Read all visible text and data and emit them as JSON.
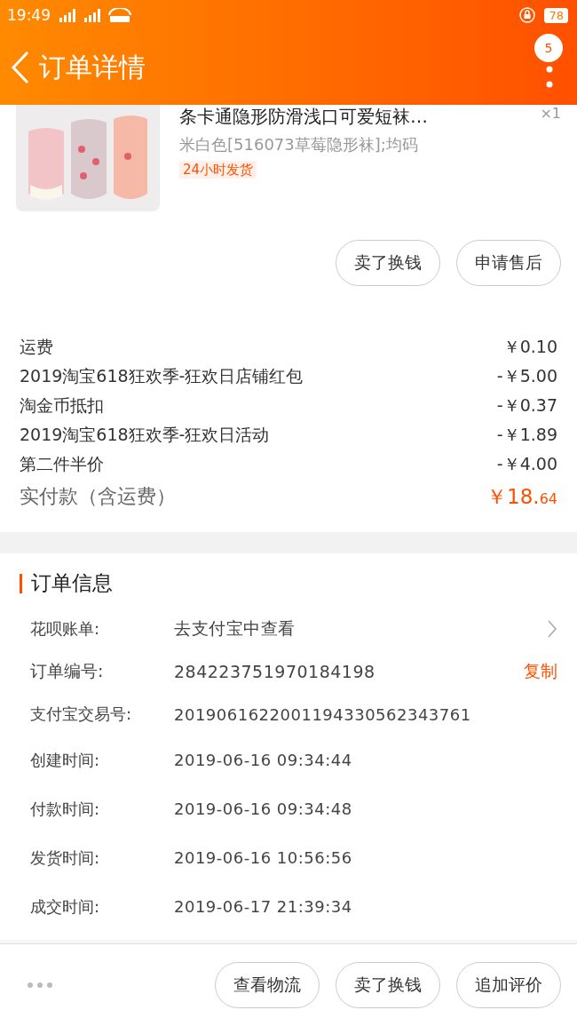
{
  "status_bar": {
    "time": "19:49",
    "battery": "78"
  },
  "header": {
    "title": "订单详情",
    "badge": "5"
  },
  "product": {
    "title": "条卡通隐形防滑浅口可爱短袜…",
    "quantity": "×1",
    "sku": "米白色[516073草莓隐形袜];均码",
    "tag": "24小时发货",
    "buttons": [
      "卖了换钱",
      "申请售后"
    ]
  },
  "charges": [
    {
      "label": "运费",
      "amount": "￥0.10"
    },
    {
      "label": "2019淘宝618狂欢季-狂欢日店铺红包",
      "amount": "-￥5.00"
    },
    {
      "label": "淘金币抵扣",
      "amount": "-￥0.37"
    },
    {
      "label": "2019淘宝618狂欢季-狂欢日活动",
      "amount": "-￥1.89"
    },
    {
      "label": "第二件半价",
      "amount": "-￥4.00"
    }
  ],
  "total": {
    "label": "实付款（含运费）",
    "amount_main": "￥18.",
    "amount_cents": "64"
  },
  "order_info": {
    "title": "订单信息",
    "rows": [
      {
        "kind": "link",
        "label": "花呗账单:",
        "value": "去支付宝中查看"
      },
      {
        "kind": "copy",
        "label": "订单编号:",
        "value": "284223751970184198",
        "action": "复制"
      },
      {
        "kind": "plain",
        "label": "支付宝交易号:",
        "value": "2019061622001194330562343761"
      },
      {
        "kind": "plain",
        "label": "创建时间:",
        "value": "2019-06-16 09:34:44"
      },
      {
        "kind": "plain",
        "label": "付款时间:",
        "value": "2019-06-16 09:34:48"
      },
      {
        "kind": "plain",
        "label": "发货时间:",
        "value": "2019-06-16 10:56:56"
      },
      {
        "kind": "plain",
        "label": "成交时间:",
        "value": "2019-06-17 21:39:34"
      }
    ]
  },
  "bottom_bar": {
    "buttons": [
      "查看物流",
      "卖了换钱",
      "追加评价"
    ]
  }
}
